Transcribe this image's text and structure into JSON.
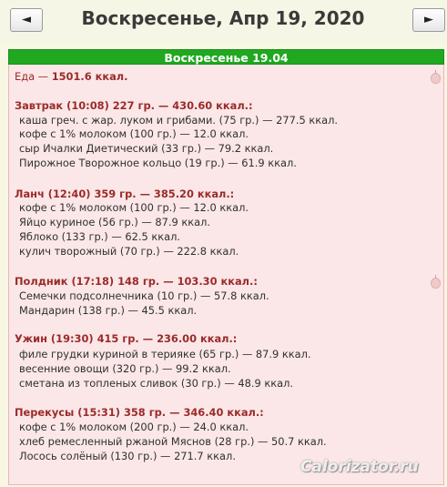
{
  "header": {
    "prev_label": "◄",
    "title": "Воскресенье, Апр 19, 2020",
    "next_label": "►"
  },
  "day_header": "Воскресенье 19.04",
  "total": {
    "label": "Еда — ",
    "value": "1501.6 ккал."
  },
  "meals": [
    {
      "header": "Завтрак (10:08) 227 гр. — 430.60 ккал.:",
      "items": [
        "каша греч. с жар. луком и грибами. (75 гр.) — 277.5 ккал.",
        "кофе с 1% молоком (100 гр.) — 12.0 ккал.",
        "сыр Ичалки Диетический (33 гр.) — 79.2 ккал.",
        "Пирожное Творожное кольцо (19 гр.) — 61.9 ккал."
      ]
    },
    {
      "header": "Ланч (12:40) 359 гр. — 385.20 ккал.:",
      "items": [
        "кофе с 1% молоком (100 гр.) — 12.0 ккал.",
        "Яйцо куриное (56 гр.) — 87.9 ккал.",
        "Яблоко (133 гр.) — 62.5 ккал.",
        "кулич творожный (70 гр.) — 222.8 ккал."
      ]
    },
    {
      "header": "Полдник (17:18) 148 гр. — 103.30 ккал.:",
      "items": [
        "Семечки подсолнечника (10 гр.) — 57.8 ккал.",
        "Мандарин (138 гр.) — 45.5 ккал."
      ]
    },
    {
      "header": "Ужин (19:30) 415 гр. — 236.00 ккал.:",
      "items": [
        "филе грудки куриной в терияке (65 гр.) — 87.9 ккал.",
        "весенние овощи (320 гр.) — 99.2 ккал.",
        "сметана из топленых сливок (30 гр.) — 48.9 ккал."
      ]
    },
    {
      "header": "Перекусы (15:31) 358 гр. — 346.40 ккал.:",
      "items": [
        "кофе с 1% молоком (200 гр.) — 24.0 ккал.",
        "хлеб ремесленный ржаной Мяснов (28 гр.) — 50.7 ккал.",
        "Лосось солёный (130 гр.) — 271.7 ккал."
      ]
    }
  ],
  "watermark": "Calorizator.ru",
  "colors": {
    "header_green": "#20a820",
    "panel_pink": "#fbe7e7",
    "meal_red": "#9b2b2b"
  },
  "icons": {
    "apple": "apple-icon"
  }
}
